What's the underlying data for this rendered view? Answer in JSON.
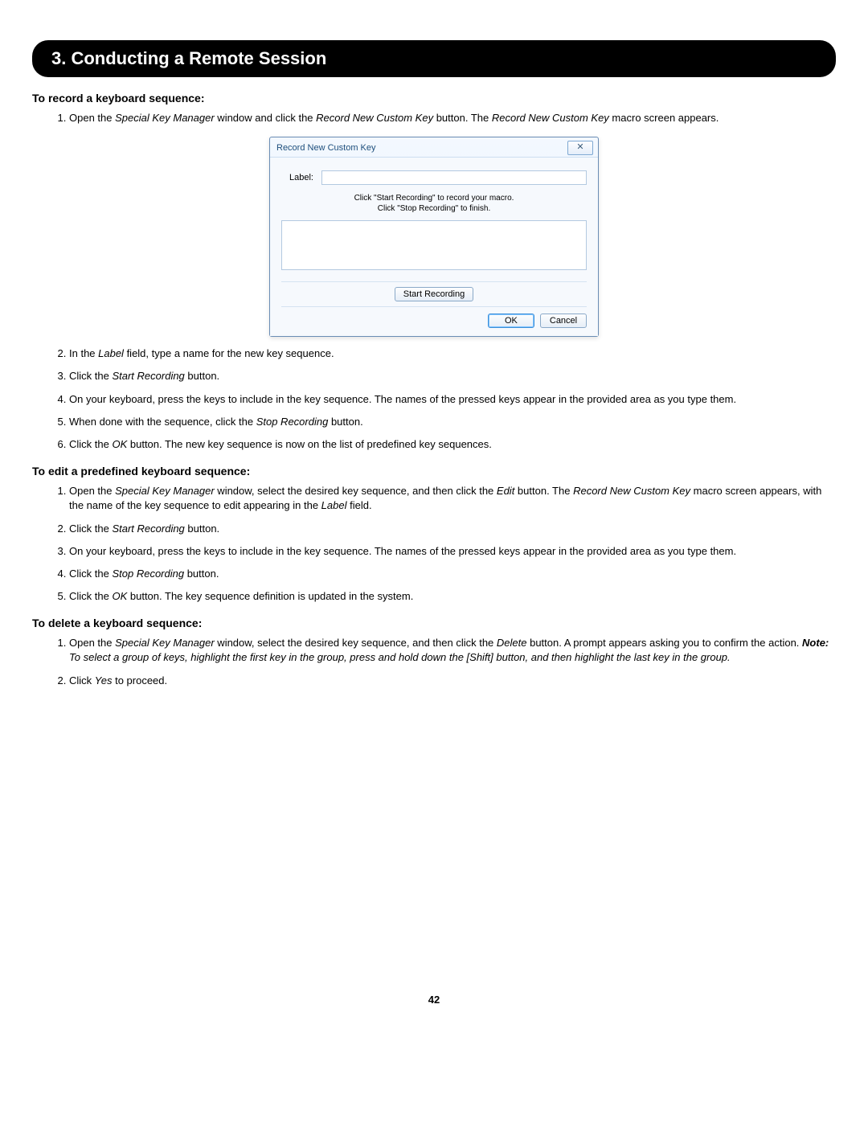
{
  "header": "3. Conducting a Remote Session",
  "section1": {
    "title": "To record a keyboard sequence:",
    "steps": [
      {
        "pre": "Open the ",
        "em1": "Special Key Manager",
        "mid1": " window and click the ",
        "em2": "Record New Custom Key",
        "mid2": " button. The ",
        "em3": "Record New Custom Key",
        "post": " macro screen appears."
      },
      {
        "pre": "In the ",
        "em1": "Label",
        "post": " field, type a name for the new key sequence."
      },
      {
        "pre": "Click the ",
        "em1": "Start Recording",
        "post": " button."
      },
      {
        "plain": "On your keyboard, press the keys to include in the key sequence. The names of the pressed keys appear in the provided area as you type them."
      },
      {
        "pre": "When done with the sequence, click the ",
        "em1": "Stop Recording",
        "post": " button."
      },
      {
        "pre": "Click the ",
        "em1": "OK",
        "post": " button. The new key sequence is now on the list of predefined key sequences."
      }
    ]
  },
  "dialog": {
    "title": "Record New Custom Key",
    "close": "✕",
    "label": "Label:",
    "hint1": "Click \"Start Recording\" to record your macro.",
    "hint2": "Click \"Stop Recording\" to finish.",
    "startBtn": "Start Recording",
    "okBtn": "OK",
    "cancelBtn": "Cancel"
  },
  "section2": {
    "title": "To edit a predefined keyboard sequence:",
    "steps": [
      {
        "pre": "Open the ",
        "em1": "Special Key Manager",
        "mid1": " window, select the desired key sequence, and then click the ",
        "em2": "Edit",
        "mid2": " button. The ",
        "em3": "Record New Custom Key",
        "mid3": " macro screen appears, with the name of the key sequence to edit appearing in the ",
        "em4": "Label",
        "post": " field."
      },
      {
        "pre": "Click the ",
        "em1": "Start Recording",
        "post": " button."
      },
      {
        "plain": "On your keyboard, press the keys to include in the key sequence. The names of the pressed keys appear in the provided area as you type them."
      },
      {
        "pre": "Click the ",
        "em1": "Stop Recording",
        "post": " button."
      },
      {
        "pre": "Click the ",
        "em1": "OK",
        "post": " button. The key sequence definition is updated in the system."
      }
    ]
  },
  "section3": {
    "title": "To delete a keyboard sequence:",
    "steps": [
      {
        "pre": "Open the ",
        "em1": "Special Key Manager",
        "mid1": " window, select the desired key sequence, and then click the ",
        "em2": "Delete",
        "mid2": " button. A prompt appears asking you to confirm the action. ",
        "boldEm": "Note:",
        "em3post": " To select a group of keys, highlight the first key in the group, press and hold down the [Shift] button, and then highlight the last key in the group."
      },
      {
        "pre": "Click ",
        "em1": "Yes",
        "post": " to proceed."
      }
    ]
  },
  "pageNumber": "42"
}
